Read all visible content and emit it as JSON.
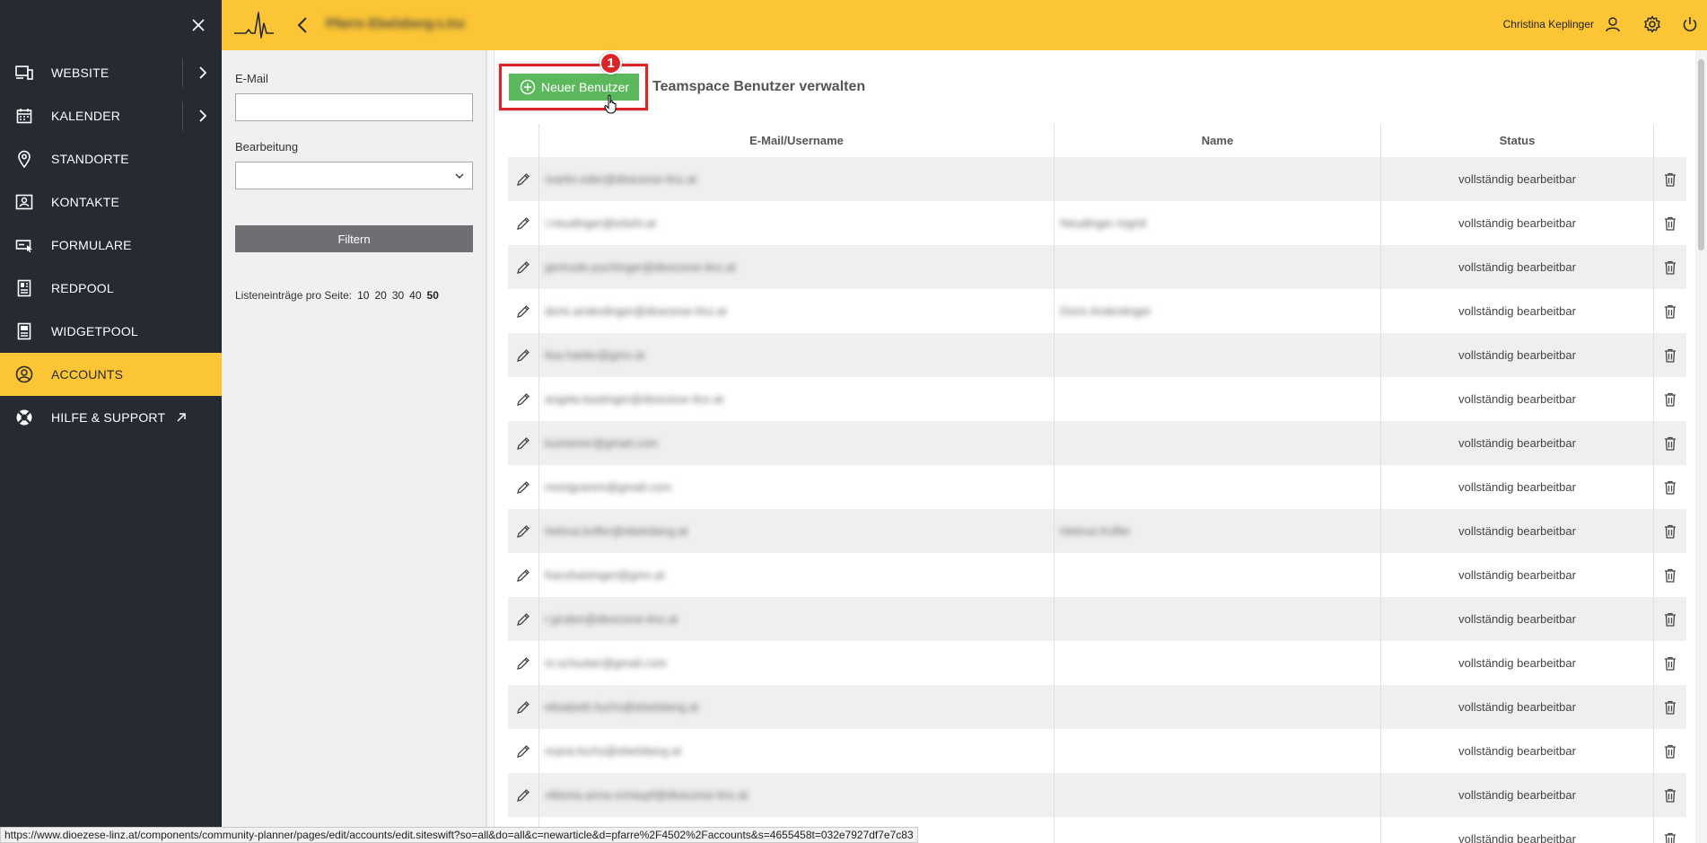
{
  "sidebar": {
    "items": [
      {
        "label": "WEBSITE",
        "icon": "monitor-devices-icon",
        "arrow": true
      },
      {
        "label": "KALENDER",
        "icon": "calendar-icon",
        "arrow": true
      },
      {
        "label": "STANDORTE",
        "icon": "location-pin-icon"
      },
      {
        "label": "KONTAKTE",
        "icon": "contact-card-icon"
      },
      {
        "label": "FORMULARE",
        "icon": "form-icon"
      },
      {
        "label": "REDPOOL",
        "icon": "document-pool-icon"
      },
      {
        "label": "WIDGETPOOL",
        "icon": "widget-icon"
      },
      {
        "label": "ACCOUNTS",
        "icon": "user-circle-icon",
        "active": true
      },
      {
        "label": "HILFE & SUPPORT",
        "icon": "lifebuoy-icon",
        "external": true
      }
    ]
  },
  "topbar": {
    "site_title": "Pfarre Ebelsberg-Linz",
    "user_name": "Christina Keplinger"
  },
  "filter": {
    "email_label": "E-Mail",
    "email_value": "",
    "edit_label": "Bearbeitung",
    "edit_selected": "",
    "filter_button": "Filtern",
    "per_page_label": "Listeneinträge pro Seite:",
    "per_page_options": [
      "10",
      "20",
      "30",
      "40",
      "50"
    ],
    "per_page_selected": "50"
  },
  "main": {
    "new_user_button": "Neuer Benutzer",
    "badge_number": "1",
    "heading": "Teamspace Benutzer verwalten",
    "table": {
      "headers": {
        "email": "E-Mail/Username",
        "name": "Name",
        "status": "Status"
      },
      "rows": [
        {
          "email": "martin.eder@dioezese-linz.at",
          "name": "",
          "status": "vollständig bearbeitbar"
        },
        {
          "email": "i.neudinger@eduhi.at",
          "name": "Neudinger Ingrid",
          "status": "vollständig bearbeitbar"
        },
        {
          "email": "gertrude.puchinger@dioezese-linz.at",
          "name": "",
          "status": "vollständig bearbeitbar"
        },
        {
          "email": "doris.andexlinger@dioezese-linz.at",
          "name": "Doris Andexlinger",
          "status": "vollständig bearbeitbar"
        },
        {
          "email": "lisa.haider@gmx.at",
          "name": "",
          "status": "vollständig bearbeitbar"
        },
        {
          "email": "angela.kastinger@dioezese-linz.at",
          "name": "",
          "status": "vollständig bearbeitbar"
        },
        {
          "email": "kumeiner@gmail.com",
          "name": "",
          "status": "vollständig bearbeitbar"
        },
        {
          "email": "monigramm@gmail.com",
          "name": "",
          "status": "vollständig bearbeitbar"
        },
        {
          "email": "helmut.kofler@ebelsberg.at",
          "name": "Helmut Kofler",
          "status": "vollständig bearbeitbar"
        },
        {
          "email": "franzkaisinger@gmx.at",
          "name": "",
          "status": "vollständig bearbeitbar"
        },
        {
          "email": "r.gruber@dioezese-linz.at",
          "name": "",
          "status": "vollständig bearbeitbar"
        },
        {
          "email": "m.schuster@gmail.com",
          "name": "",
          "status": "vollständig bearbeitbar"
        },
        {
          "email": "elisabeth.fuchs@ebelsberg.at",
          "name": "",
          "status": "vollständig bearbeitbar"
        },
        {
          "email": "maria.fuchs@ebelsberg.at",
          "name": "",
          "status": "vollständig bearbeitbar"
        },
        {
          "email": "viktoria.anna.schaupf@dioezese-linz.at",
          "name": "",
          "status": "vollständig bearbeitbar"
        },
        {
          "email": "",
          "name": "",
          "status": "vollständig bearbeitbar"
        }
      ]
    }
  },
  "status_url": "https://www.dioezese-linz.at/components/community-planner/pages/edit/accounts/edit.siteswift?so=all&do=all&c=newarticle&d=pfarre%2F4502%2Faccounts&s=4655458t=032e7927df7e7c83",
  "colors": {
    "sidebar_bg": "#252a33",
    "accent_yellow": "#fcc535",
    "green_button": "#5cb85c",
    "highlight_red": "#d9252a",
    "filter_button": "#6e6f72"
  }
}
